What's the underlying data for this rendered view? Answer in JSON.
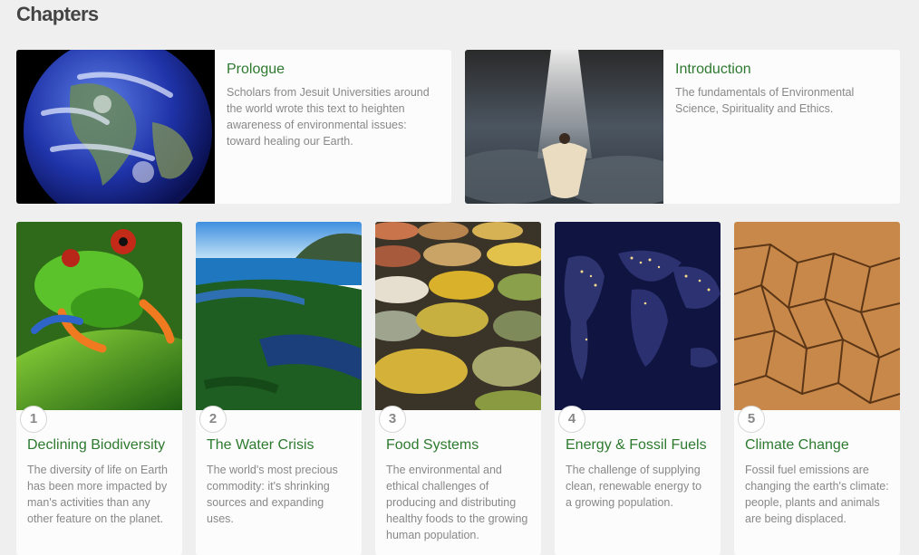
{
  "page": {
    "heading": "Chapters"
  },
  "featured": [
    {
      "title": "Prologue",
      "description": "Scholars from Jesuit Universities around the world wrote this text to heighten awareness of environmental issues: toward healing our Earth.",
      "image": "earth-globe-image"
    },
    {
      "title": "Introduction",
      "description": "The fundamentals of Environmental Science, Spirituality and Ethics.",
      "image": "woman-under-light-image"
    }
  ],
  "chapters": [
    {
      "number": "1",
      "title": "Declining Biodiversity",
      "description": "The diversity of life on Earth has been more impacted by man's activities than any other feature on the planet.",
      "image": "tree-frog-image"
    },
    {
      "number": "2",
      "title": "The Water Crisis",
      "description": "The world's most precious commodity: it's shrinking sources and expanding uses.",
      "image": "rainforest-river-image"
    },
    {
      "number": "3",
      "title": "Food Systems",
      "description": "The environmental and ethical challenges of producing and distributing healthy foods to the growing human population.",
      "image": "grain-bowls-image"
    },
    {
      "number": "4",
      "title": "Energy & Fossil Fuels",
      "description": "The challenge of supplying clean, renewable energy to a growing population.",
      "image": "earth-at-night-image"
    },
    {
      "number": "5",
      "title": "Climate Change",
      "description": "Fossil fuel emissions are changing the earth's climate: people, plants and animals are being displaced.",
      "image": "cracked-earth-image"
    }
  ],
  "colors": {
    "title_green": "#2d7a2f",
    "description_gray": "#888888",
    "background": "#efefef"
  }
}
